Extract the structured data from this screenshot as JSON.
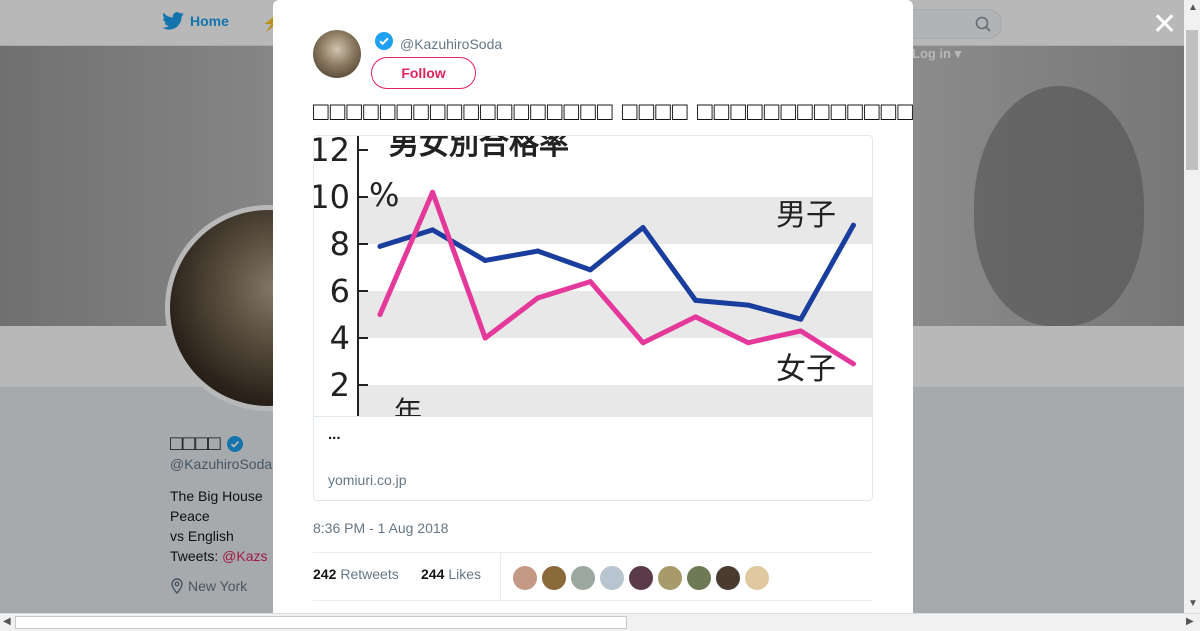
{
  "nav": {
    "home_label": "Home"
  },
  "header": {
    "login_label": "Log in"
  },
  "profile": {
    "name": "□□□□",
    "handle": "@KazuhiroSoda",
    "bio_lines": [
      "The Big House",
      "Peace",
      "vs English",
      "Tweets: "
    ],
    "bio_link": "@Kazs",
    "location": "New York"
  },
  "tweet": {
    "handle": "@KazuhiroSoda",
    "follow_label": "Follow",
    "text": "□□□□□□□□□□□□□□□□□□ □□□□ □□□□□□□□□□□□□□□□□□□□□□□□□□□□□□□□□□□□□",
    "card": {
      "title": "...",
      "domain": "yomiuri.co.jp"
    },
    "timestamp": "8:36 PM - 1 Aug 2018",
    "retweets_count": "242",
    "retweets_label": "Retweets",
    "likes_count": "244",
    "likes_label": "Likes",
    "liker_colors": [
      "#c49a85",
      "#8a6a3b",
      "#9aa8a0",
      "#b8c4cf",
      "#5b3b4a",
      "#a89a6a",
      "#6d7a55",
      "#4a3a30",
      "#e0c8a0"
    ]
  },
  "chart_data": {
    "type": "line",
    "title": "男女別合格率",
    "x": [
      1,
      2,
      3,
      4,
      5,
      6,
      7,
      8,
      9,
      10,
      11
    ],
    "ylim": [
      0,
      12
    ],
    "y_ticks": [
      "12",
      "10",
      "8",
      "6",
      "4",
      "2"
    ],
    "y_unit": "%",
    "x_axis_word": "年",
    "grid": true,
    "series": [
      {
        "name": "男子",
        "color": "#1a3e9e",
        "values": [
          7.9,
          8.6,
          7.3,
          7.7,
          6.9,
          8.7,
          5.6,
          5.4,
          4.8,
          8.8
        ]
      },
      {
        "name": "女子",
        "color": "#e4399b",
        "values": [
          5.0,
          10.2,
          4.0,
          5.7,
          6.4,
          3.8,
          4.9,
          3.8,
          4.3,
          2.9
        ]
      }
    ]
  }
}
